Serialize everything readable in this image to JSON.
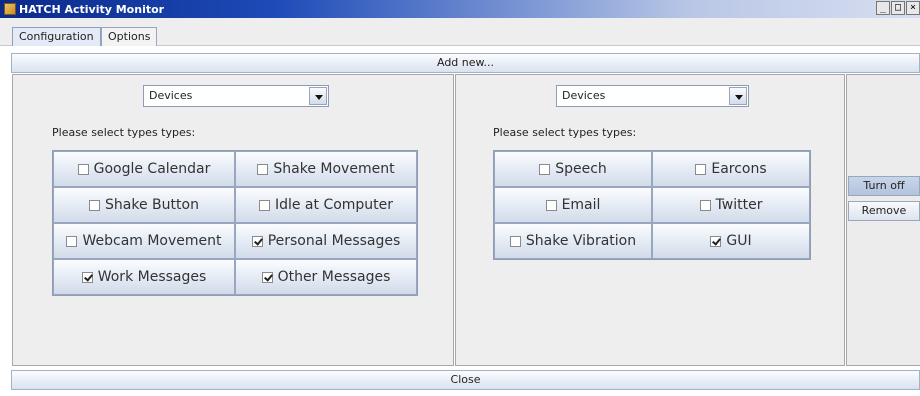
{
  "window": {
    "title": "HATCH Activity Monitor",
    "controls": [
      "_",
      "□",
      "×"
    ]
  },
  "tabs": [
    {
      "label": "Configuration",
      "active": true
    },
    {
      "label": "Options",
      "active": false
    }
  ],
  "add_new_label": "Add new...",
  "left_panel": {
    "select_value": "Devices",
    "prompt": "Please select types types:",
    "options": [
      {
        "label": "Google Calendar",
        "checked": false
      },
      {
        "label": "Shake Movement",
        "checked": false
      },
      {
        "label": "Shake Button",
        "checked": false
      },
      {
        "label": "Idle at Computer",
        "checked": false
      },
      {
        "label": "Webcam Movement",
        "checked": false
      },
      {
        "label": "Personal Messages",
        "checked": true
      },
      {
        "label": "Work Messages",
        "checked": true
      },
      {
        "label": "Other Messages",
        "checked": true
      }
    ]
  },
  "right_panel": {
    "select_value": "Devices",
    "prompt": "Please select types types:",
    "options": [
      {
        "label": "Speech",
        "checked": false
      },
      {
        "label": "Earcons",
        "checked": false
      },
      {
        "label": "Email",
        "checked": false
      },
      {
        "label": "Twitter",
        "checked": false
      },
      {
        "label": "Shake Vibration",
        "checked": false
      },
      {
        "label": "GUI",
        "checked": true
      }
    ]
  },
  "side_buttons": {
    "turn_off": "Turn off",
    "remove": "Remove"
  },
  "close_label": "Close"
}
